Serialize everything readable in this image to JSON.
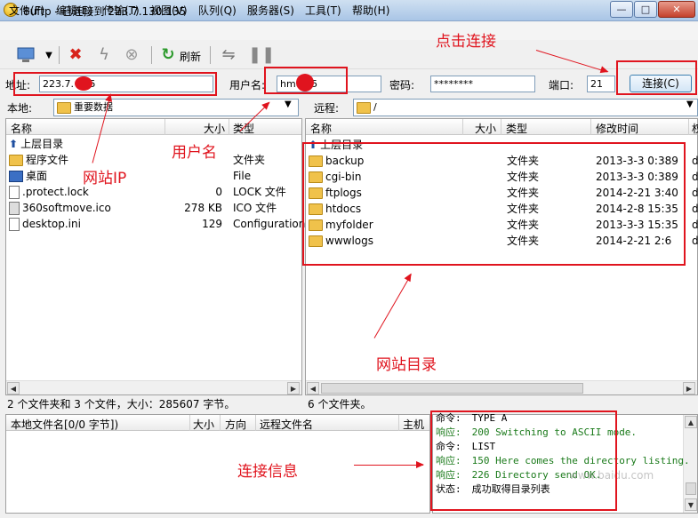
{
  "window": {
    "title": "8uftp - 已连接到 223.7.130.135",
    "min": "—",
    "max": "□",
    "close": "✕"
  },
  "menu": [
    "文件(F)",
    "编辑(E)",
    "传输(T)",
    "视图(V)",
    "队列(Q)",
    "服务器(S)",
    "工具(T)",
    "帮助(H)"
  ],
  "toolbar": {
    "refresh_label": "刷新"
  },
  "connection": {
    "address_label": "地址:",
    "address_value": "223.7.   135",
    "user_label": "用户名:",
    "user_value": "hmu   35",
    "password_label": "密码:",
    "password_value": "********",
    "port_label": "端口:",
    "port_value": "21",
    "connect_label": "连接(C)"
  },
  "local": {
    "path_label": "本地:",
    "path_value": "重要数据",
    "columns": {
      "name": "名称",
      "size": "大小",
      "type": "类型"
    },
    "rows": [
      {
        "name": "上层目录",
        "size": "",
        "type": ""
      },
      {
        "name": "程序文件",
        "size": "",
        "type": "文件夹"
      },
      {
        "name": "桌面",
        "size": "",
        "type": "File"
      },
      {
        "name": ".protect.lock",
        "size": "0",
        "type": "LOCK 文件"
      },
      {
        "name": "360softmove.ico",
        "size": "278 KB",
        "type": "ICO 文件"
      },
      {
        "name": "desktop.ini",
        "size": "129",
        "type": "Configuration"
      }
    ],
    "status": "2 个文件夹和 3 个文件，大小：285607 字节。"
  },
  "remote": {
    "path_label": "远程:",
    "path_value": "/",
    "columns": {
      "name": "名称",
      "size": "大小",
      "type": "类型",
      "modified": "修改时间",
      "extra": "权"
    },
    "rows": [
      {
        "name": "上层目录",
        "type": "",
        "modified": "",
        "extra": ""
      },
      {
        "name": "backup",
        "type": "文件夹",
        "modified": "2013-3-3 0:389",
        "extra": "d"
      },
      {
        "name": "cgi-bin",
        "type": "文件夹",
        "modified": "2013-3-3 0:389",
        "extra": "d"
      },
      {
        "name": "ftplogs",
        "type": "文件夹",
        "modified": "2014-2-21 3:40",
        "extra": "d"
      },
      {
        "name": "htdocs",
        "type": "文件夹",
        "modified": "2014-2-8 15:35",
        "extra": "d"
      },
      {
        "name": "myfolder",
        "type": "文件夹",
        "modified": "2013-3-3 15:35",
        "extra": "d"
      },
      {
        "name": "wwwlogs",
        "type": "文件夹",
        "modified": "2014-2-21 2:6",
        "extra": "d"
      }
    ],
    "status": "6 个文件夹。"
  },
  "queue": {
    "columns": {
      "local_name": "本地文件名[0/0 字节])",
      "size": "大小",
      "direction": "方向",
      "remote_name": "远程文件名",
      "host": "主机"
    }
  },
  "log": [
    {
      "label": "命令:",
      "text": "TYPE A",
      "color": "#000000"
    },
    {
      "label": "响应:",
      "text": "200 Switching to ASCII mode.",
      "color": "#1a7a1a"
    },
    {
      "label": "命令:",
      "text": "LIST",
      "color": "#000000"
    },
    {
      "label": "响应:",
      "text": "150 Here comes the directory listing.",
      "color": "#1a7a1a"
    },
    {
      "label": "响应:",
      "text": "226 Directory send OK.",
      "color": "#1a7a1a"
    },
    {
      "label": "状态:",
      "text": "成功取得目录列表",
      "color": "#000000"
    }
  ],
  "annotations": {
    "click_connect": "点击连接",
    "site_ip": "网站IP",
    "username": "用户名",
    "site_dir": "网站目录",
    "conn_info": "连接信息"
  },
  "watermark": "www.baidu.com"
}
